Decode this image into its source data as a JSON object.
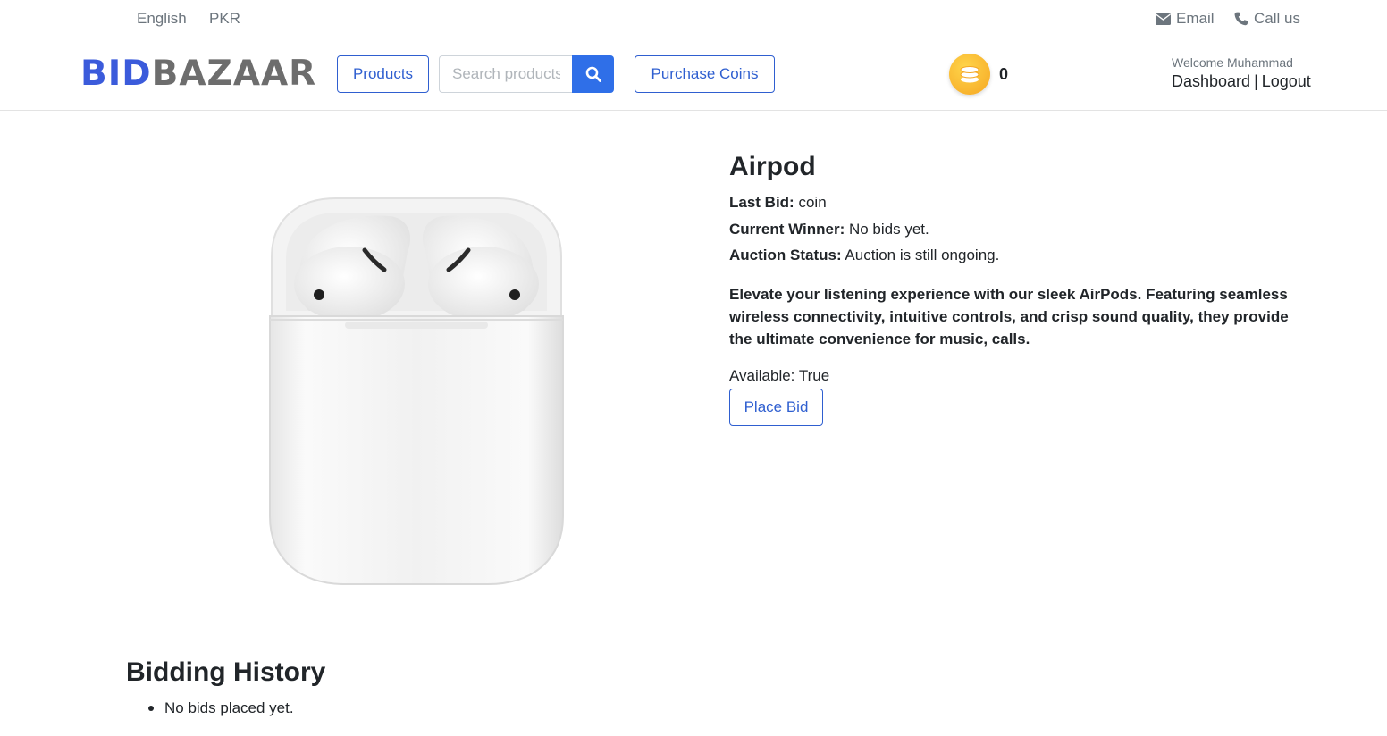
{
  "topbar": {
    "language": "English",
    "currency": "PKR",
    "email_label": "Email",
    "call_label": "Call us"
  },
  "header": {
    "logo_bid": "BID",
    "logo_bazaar": "BAZAAR",
    "products_label": "Products",
    "search_placeholder": "Search products",
    "purchase_coins_label": "Purchase Coins",
    "coin_count": "0",
    "welcome": "Welcome Muhammad",
    "dashboard_label": "Dashboard",
    "separator": "|",
    "logout_label": "Logout"
  },
  "product": {
    "title": "Airpod",
    "last_bid_label": "Last Bid:",
    "last_bid_value": " coin",
    "winner_label": "Current Winner:",
    "winner_value": " No bids yet.",
    "status_label": "Auction Status:",
    "status_value": " Auction is still ongoing.",
    "description": "Elevate your listening experience with our sleek AirPods. Featuring seamless wireless connectivity, intuitive controls, and crisp sound quality, they provide the ultimate convenience for music, calls.",
    "available": "Available: True",
    "place_bid_label": "Place Bid"
  },
  "history": {
    "title": "Bidding History",
    "empty": "No bids placed yet."
  },
  "colors": {
    "primary": "#2f5fd0",
    "search_button": "#2f6fe8",
    "logo_bid": "#3b5bdb",
    "logo_bazaar": "#6d6d6d",
    "coin": "#f5a623"
  }
}
